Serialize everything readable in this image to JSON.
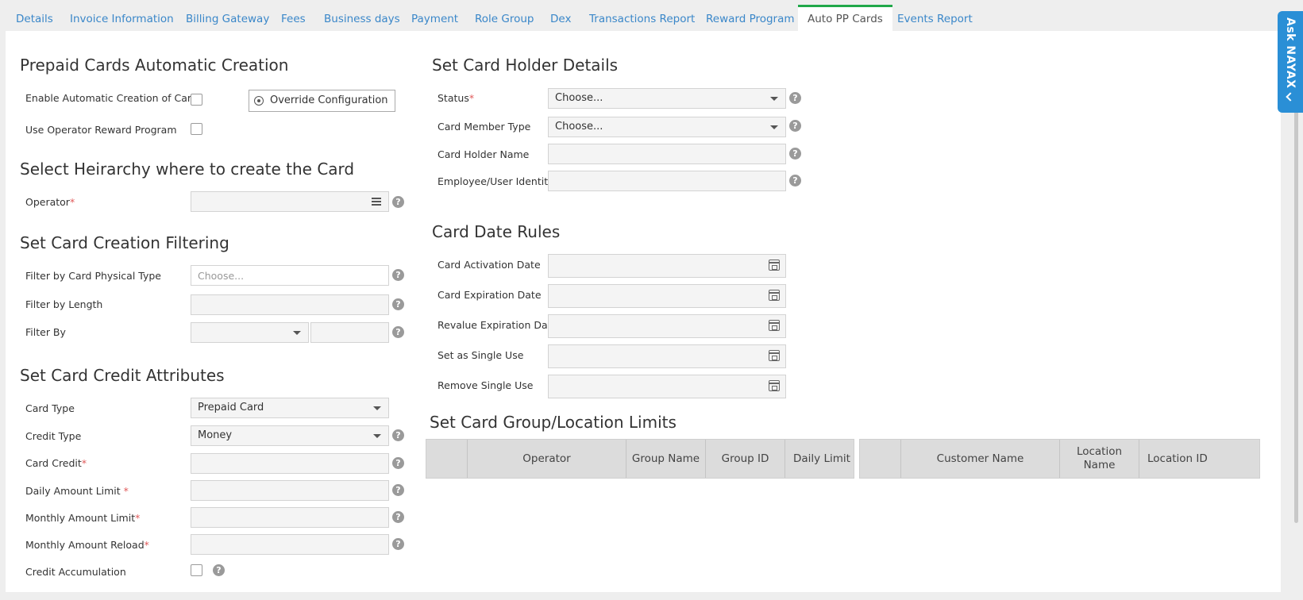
{
  "tabs": [
    {
      "label": "Details"
    },
    {
      "label": "Invoice Information"
    },
    {
      "label": "Billing Gateway"
    },
    {
      "label": "Fees"
    },
    {
      "label": "Business days"
    },
    {
      "label": "Payment"
    },
    {
      "label": "Role Group"
    },
    {
      "label": "Dex"
    },
    {
      "label": "Transactions Report"
    },
    {
      "label": "Reward Program"
    },
    {
      "label": "Auto PP Cards"
    },
    {
      "label": "Events Report"
    }
  ],
  "active_tab": "Auto PP Cards",
  "ask_nayax": {
    "label": "Ask NAYAX"
  },
  "auto_creation": {
    "title": "Prepaid Cards Automatic Creation",
    "enable_label": "Enable Automatic Creation of Cards",
    "override_button": "Override Configuration",
    "reward_label": "Use Operator Reward Program"
  },
  "hierarchy": {
    "title": "Select Heirarchy where to create the Card",
    "operator_label": "Operator",
    "operator_value": ""
  },
  "filtering": {
    "title": "Set Card Creation Filtering",
    "physical_type_label": "Filter by Card Physical Type",
    "physical_type_placeholder": "Choose...",
    "length_label": "Filter by Length",
    "filter_by_label": "Filter By",
    "filter_by_value": ""
  },
  "credit": {
    "title": "Set Card Credit Attributes",
    "card_type_label": "Card Type",
    "card_type_value": "Prepaid Card",
    "credit_type_label": "Credit Type",
    "credit_type_value": "Money",
    "card_credit_label": "Card Credit",
    "daily_limit_label": "Daily Amount Limit ",
    "monthly_limit_label": "Monthly Amount Limit",
    "monthly_reload_label": "Monthly Amount Reload",
    "accumulation_label": "Credit Accumulation"
  },
  "holder": {
    "title": "Set Card Holder Details",
    "status_label": "Status",
    "status_value": "Choose...",
    "member_type_label": "Card Member Type",
    "member_type_value": "Choose...",
    "holder_name_label": "Card Holder Name",
    "identity_label": "Employee/User Identity"
  },
  "date_rules": {
    "title": "Card Date Rules",
    "activation_label": "Card Activation Date",
    "expiration_label": "Card Expiration Date",
    "revalue_label": "Revalue Expiration Date",
    "single_use_label": "Set as Single Use",
    "remove_single_label": "Remove Single Use"
  },
  "limits": {
    "title": "Set Card Group/Location Limits",
    "group_columns": [
      "",
      "Operator",
      "Group Name",
      "Group ID",
      "Daily Limit"
    ],
    "location_columns": [
      "",
      "Customer Name",
      "Location Name",
      "Location ID"
    ]
  },
  "required_mark": "*",
  "help_glyph": "?"
}
